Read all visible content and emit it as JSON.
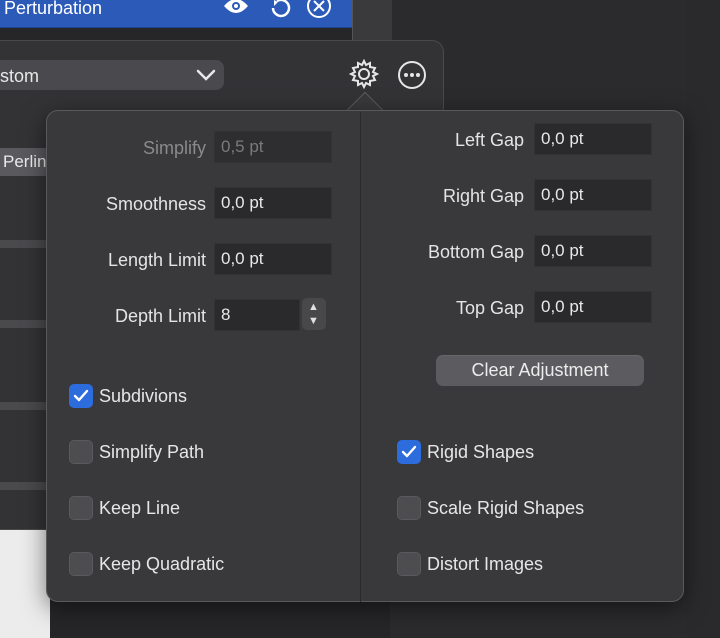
{
  "background": {
    "top_row_label": "Perturbation",
    "dropdown_value": "stom",
    "perlin_label": "Perlin"
  },
  "icons": {
    "eye": "eye-icon",
    "reset": "reset-icon",
    "close": "close-circle-icon",
    "gear": "gear-icon",
    "more": "more-icon",
    "chevron": "chevron-down-icon"
  },
  "colors": {
    "accent": "#2c6cdc",
    "selection": "#2b5ab8"
  },
  "left_fields": [
    {
      "label": "Simplify",
      "value": "0,5 pt",
      "disabled": true
    },
    {
      "label": "Smoothness",
      "value": "0,0 pt"
    },
    {
      "label": "Length Limit",
      "value": "0,0 pt"
    },
    {
      "label": "Depth Limit",
      "value": "8"
    }
  ],
  "right_fields": [
    {
      "label": "Left Gap",
      "value": "0,0 pt"
    },
    {
      "label": "Right Gap",
      "value": "0,0 pt"
    },
    {
      "label": "Bottom Gap",
      "value": "0,0 pt"
    },
    {
      "label": "Top Gap",
      "value": "0,0 pt"
    }
  ],
  "clear_button": "Clear Adjustment",
  "left_checks": [
    {
      "label": "Subdivions",
      "checked": true
    },
    {
      "label": "Simplify Path",
      "checked": false
    },
    {
      "label": "Keep Line",
      "checked": false
    },
    {
      "label": "Keep Quadratic",
      "checked": false
    }
  ],
  "right_checks": [
    {
      "label": "Rigid Shapes",
      "checked": true
    },
    {
      "label": "Scale Rigid Shapes",
      "checked": false
    },
    {
      "label": "Distort Images",
      "checked": false
    }
  ]
}
